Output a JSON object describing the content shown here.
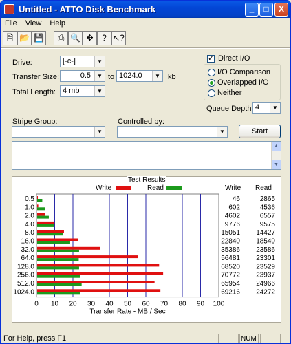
{
  "window": {
    "title": "Untitled - ATTO Disk Benchmark",
    "controls": [
      "_",
      "□",
      "X"
    ]
  },
  "menu": [
    "File",
    "View",
    "Help"
  ],
  "toolbar": [
    "new-icon",
    "open-icon",
    "save-icon",
    "print-icon",
    "print-preview-icon",
    "move-icon",
    "about-icon",
    "context-help-icon"
  ],
  "form": {
    "drive_label": "Drive:",
    "drive_value": "[-c-]",
    "transfer_size_label": "Transfer Size:",
    "transfer_from": "0.5",
    "to_label": "to",
    "transfer_to": "1024.0",
    "kb_label": "kb",
    "total_length_label": "Total Length:",
    "total_length_value": "4 mb",
    "direct_io_label": "Direct I/O",
    "direct_io_checked": true,
    "io_comparison_label": "I/O Comparison",
    "overlapped_io_label": "Overlapped I/O",
    "neither_label": "Neither",
    "selected_mode": "Overlapped I/O",
    "queue_depth_label": "Queue Depth:",
    "queue_depth_value": "4",
    "stripe_group_label": "Stripe Group:",
    "stripe_group_value": "",
    "controlled_by_label": "Controlled by:",
    "controlled_by_value": "",
    "start_label": "Start"
  },
  "results": {
    "title": "Test Results",
    "write_label": "Write",
    "read_label": "Read",
    "col_write": "Write",
    "col_read": "Read",
    "write_color": "#e01010",
    "read_color": "#1c9a1c",
    "grid_color": "#2a2aa8"
  },
  "chart_data": {
    "type": "bar",
    "orientation": "horizontal",
    "title": "Test Results",
    "xlabel": "Transfer Rate - MB / Sec",
    "xlim": [
      0,
      100
    ],
    "xticks": [
      "0",
      "10",
      "20",
      "30",
      "40",
      "50",
      "60",
      "70",
      "80",
      "90",
      "100"
    ],
    "categories": [
      "0.5",
      "1.0",
      "2.0",
      "4.0",
      "8.0",
      "16.0",
      "32.0",
      "64.0",
      "128.0",
      "256.0",
      "512.0",
      "1024.0"
    ],
    "series": [
      {
        "name": "Write",
        "values": [
          0.05,
          0.6,
          4.5,
          9.5,
          14.7,
          22.3,
          34.6,
          55.2,
          66.9,
          69.1,
          64.4,
          67.6
        ]
      },
      {
        "name": "Read",
        "values": [
          2.8,
          4.4,
          6.4,
          9.4,
          14.1,
          18.1,
          23.0,
          22.8,
          23.0,
          23.4,
          24.4,
          23.7
        ]
      }
    ],
    "write_kb": [
      "46",
      "602",
      "4602",
      "9776",
      "15051",
      "22840",
      "35386",
      "56481",
      "68520",
      "70772",
      "65954",
      "69216"
    ],
    "read_kb": [
      "2865",
      "4536",
      "6557",
      "9575",
      "14427",
      "18549",
      "23586",
      "23301",
      "23529",
      "23937",
      "24966",
      "24272"
    ],
    "grid": true,
    "legend": "top"
  },
  "status": {
    "help_text": "For Help, press F1",
    "num": "NUM"
  }
}
